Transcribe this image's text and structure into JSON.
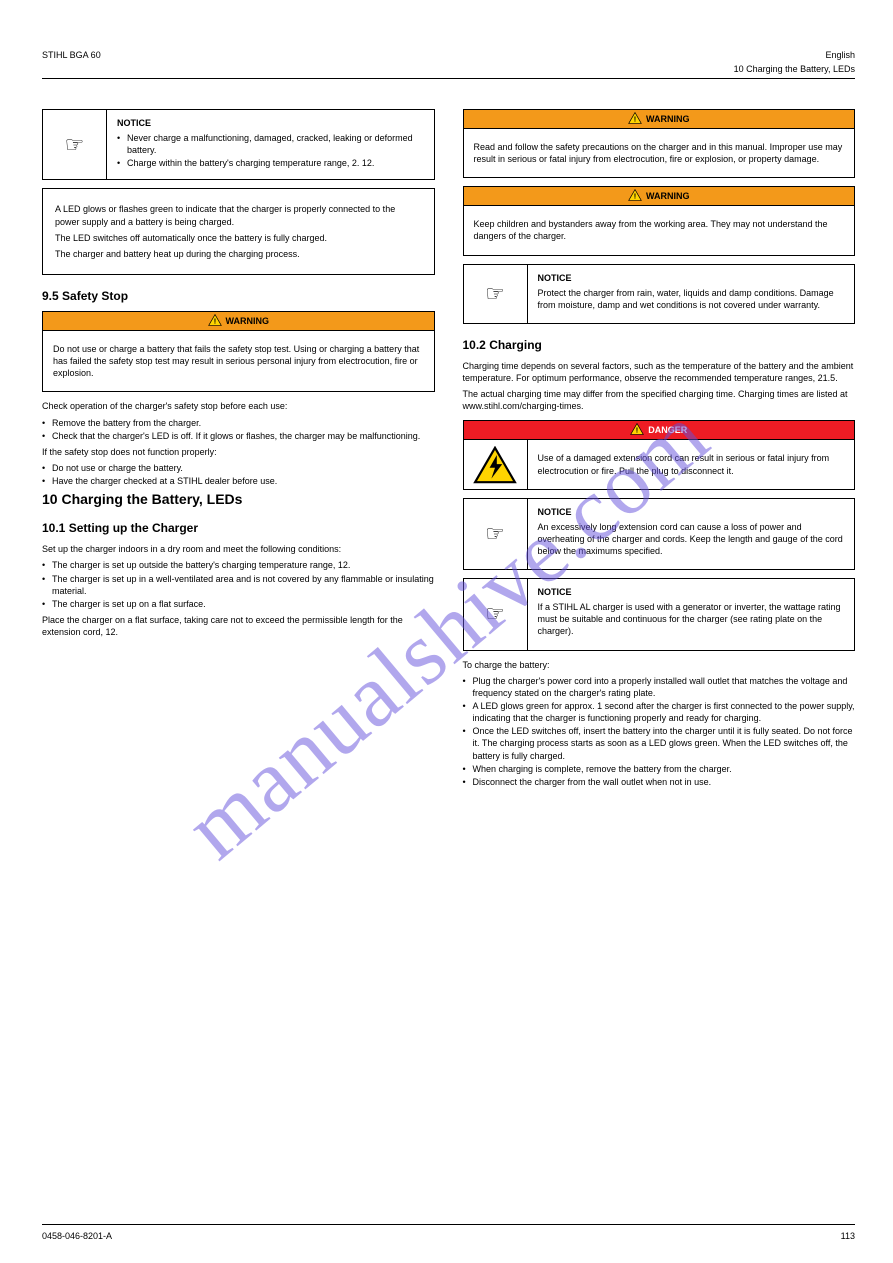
{
  "watermark": "manualshive.com",
  "header": {
    "left": "STIHL BGA 60",
    "right": "10 Charging the Battery, LEDs",
    "right_sub": "English"
  },
  "footer": {
    "code": "0458-046-8201-A",
    "page": "113"
  },
  "col1": {
    "note1": {
      "title": "NOTICE",
      "lines": [
        "Never charge a malfunctioning, damaged, cracked, leaking or deformed battery.",
        "Charge within the battery's charging temperature range, ",
        "2.",
        "12."
      ]
    },
    "plainbox": {
      "p1": "A LED glows or flashes green to indicate that the charger is properly connected to the power supply and a battery is being charged.",
      "p2": "The LED switches off automatically once the battery is fully charged.",
      "p3": "The charger and battery heat up during the charging process."
    },
    "h_sec": "9.5 Safety Stop",
    "warn1": {
      "label": "WARNING",
      "body": "Do not use or charge a battery that fails the safety stop test. Using or charging a battery that has failed the safety stop test may result in serious personal injury from electrocution, fire or explosion."
    },
    "p_after_warn": "Check operation of the charger's safety stop before each use:",
    "steps_a": [
      "Remove the battery from the charger.",
      "Check that the charger's LED is off. If it glows or flashes, the charger may be malfunctioning."
    ],
    "p_conclude": "If the safety stop does not function properly:",
    "steps_b": [
      "Do not use or charge the battery.",
      "Have the charger checked at a STIHL dealer before use."
    ],
    "h10": "10 Charging the Battery, LEDs",
    "h10_1": "10.1 Setting up the Charger",
    "p10_1": "Set up the charger indoors in a dry room and meet the following conditions:",
    "list_10_1": [
      "The charger is set up outside the battery's charging temperature range, ",
      "The charger is set up in a well-ventilated area and is not covered by any flammable or insulating material.",
      "The charger is set up on a flat surface."
    ],
    "ref_10_1": "12.",
    "p10_1b": "Place the charger on a flat surface, taking care not to exceed the permissible length for the extension cord, ",
    "ref_10_1b": "12."
  },
  "col2": {
    "warnA": {
      "label": "WARNING",
      "body": "Read and follow the safety precautions on the charger and in this manual. Improper use may result in serious or fatal injury from electrocution, fire or explosion, or property damage."
    },
    "warnB": {
      "label": "WARNING",
      "body": "Keep children and bystanders away from the working area. They may not understand the dangers of the charger."
    },
    "noteC": {
      "title": "NOTICE",
      "body": "Protect the charger from rain, water, liquids and damp conditions. Damage from moisture, damp and wet conditions is not covered under warranty."
    },
    "h10_2": "10.2 Charging",
    "p10_2a": "Charging time depends on several factors, such as the temperature of the battery and the ambient temperature. For optimum performance, observe the recommended temperature ranges, ",
    "ref10_2a": "21.5.",
    "p10_2b": "The actual charging time may differ from the specified charging time. Charging times are listed at www.stihl.com/charging-times.",
    "dangerD": {
      "label": "DANGER",
      "body": "Use of a damaged extension cord can result in serious or fatal injury from electrocution or fire. Pull the plug to disconnect it."
    },
    "noteE": {
      "title": "NOTICE",
      "body": "An excessively long extension cord can cause a loss of power and overheating of the charger and cords. Keep the length and gauge of the cord below the maximums specified."
    },
    "noteF": {
      "title": "NOTICE",
      "body": "If a STIHL AL charger is used with a generator or inverter, the wattage rating must be suitable and continuous for the charger (see rating plate on the charger)."
    },
    "p10_2c": "To charge the battery:",
    "list_10_2": [
      "Plug the charger's power cord into a properly installed wall outlet that matches the voltage and frequency stated on the charger's rating plate.",
      "A LED glows green for approx. 1 second after the charger is first connected to the power supply, indicating that the charger is functioning properly and ready for charging.",
      "Once the LED switches off, insert the battery into the charger until it is fully seated. Do not force it. The charging process starts as soon as a LED glows green. When the LED switches off, the battery is fully charged.",
      "When charging is complete, remove the battery from the charger.",
      "Disconnect the charger from the wall outlet when not in use."
    ]
  }
}
